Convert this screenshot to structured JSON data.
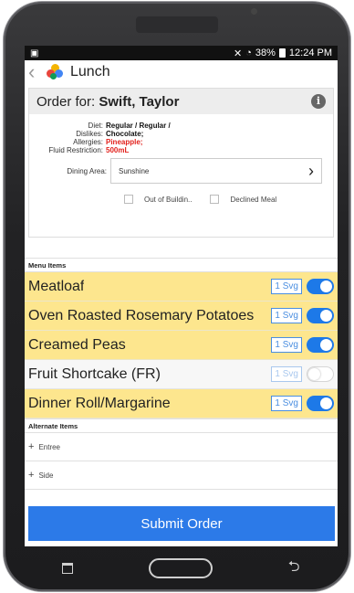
{
  "status_bar": {
    "battery": "38%",
    "time": "12:24 PM"
  },
  "app": {
    "title": "Lunch",
    "logo_colors": [
      "#f4b400",
      "#e8453c",
      "#4285f4",
      "#0f9d58"
    ]
  },
  "order": {
    "prefix": "Order for: ",
    "resident": "Swift, Taylor",
    "diet_label": "Diet:",
    "diet": "Regular / Regular /",
    "dislikes_label": "Dislikes:",
    "dislikes": "Chocolate;",
    "allergies_label": "Allergies:",
    "allergies": "Pineapple;",
    "fluid_label": "Fluid Restriction:",
    "fluid": "500mL",
    "dining_label": "Dining Area:",
    "dining_area": "Sunshine",
    "out_of_building": "Out of Buildin..",
    "declined_meal": "Declined Meal"
  },
  "menu": {
    "section_label": "Menu Items",
    "items": [
      {
        "name": "Meatloaf",
        "servings": "1 Svg",
        "selected": true
      },
      {
        "name": "Oven Roasted Rosemary Potatoes",
        "servings": "1 Svg",
        "selected": true
      },
      {
        "name": "Creamed Peas",
        "servings": "1 Svg",
        "selected": true
      },
      {
        "name": "Fruit Shortcake (FR)",
        "servings": "1 Svg",
        "selected": false
      },
      {
        "name": "Dinner Roll/Margarine",
        "servings": "1 Svg",
        "selected": true
      }
    ]
  },
  "alternates": {
    "section_label": "Alternate Items",
    "entree": "Entree",
    "side": "Side"
  },
  "submit_label": "Submit Order",
  "colors": {
    "selected_row": "#fde68e",
    "accent": "#2c7ae8",
    "allergy": "#e2211c"
  }
}
